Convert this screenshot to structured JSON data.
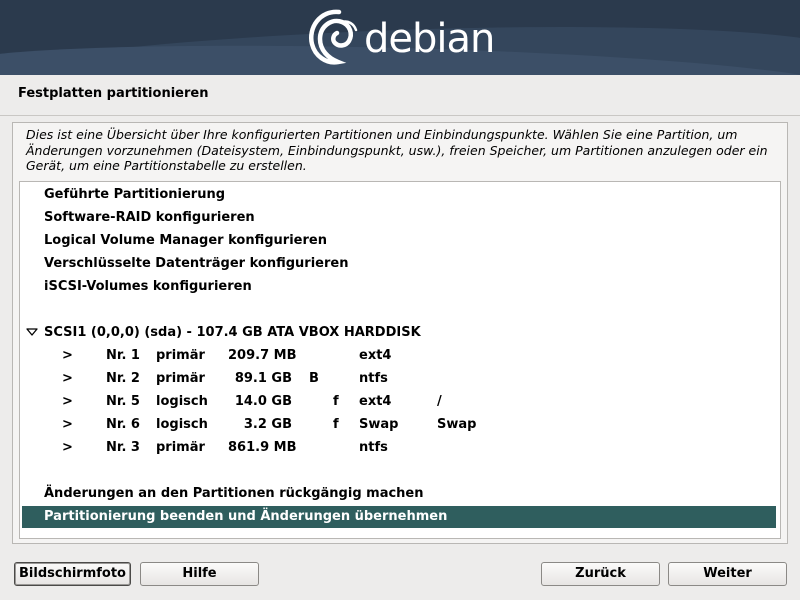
{
  "header": {
    "logo_text": "debian"
  },
  "step_title": "Festplatten partitionieren",
  "description": "Dies ist eine Übersicht über Ihre konfigurierten Partitionen und Einbindungspunkte. Wählen Sie eine Partition, um Änderungen vorzunehmen (Dateisystem, Einbindungspunkt, usw.), freien Speicher, um Partitionen anzulegen oder ein Gerät, um eine Partitionstabelle zu erstellen.",
  "menu_items": [
    "Geführte Partitionierung",
    "Software-RAID konfigurieren",
    "Logical Volume Manager konfigurieren",
    "Verschlüsselte Datenträger konfigurieren",
    "iSCSI-Volumes konfigurieren"
  ],
  "disk": {
    "label": "SCSI1 (0,0,0) (sda) - 107.4 GB ATA VBOX HARDDISK",
    "expanded": true
  },
  "partitions": [
    {
      "marker": ">",
      "nr": "Nr. 1",
      "type": "primär",
      "size": "209.7 MB",
      "flag": "",
      "fs": "ext4",
      "mount": ""
    },
    {
      "marker": ">",
      "nr": "Nr. 2",
      "type": "primär",
      "size": "89.1 GB",
      "flag": "B",
      "fs": "ntfs",
      "mount": ""
    },
    {
      "marker": ">",
      "nr": "Nr. 5",
      "type": "logisch",
      "size": "14.0 GB",
      "flag": "f",
      "fs": "ext4",
      "mount": "/"
    },
    {
      "marker": ">",
      "nr": "Nr. 6",
      "type": "logisch",
      "size": "3.2 GB",
      "flag": "f",
      "fs": "Swap",
      "mount": "Swap"
    },
    {
      "marker": ">",
      "nr": "Nr. 3",
      "type": "primär",
      "size": "861.9 MB",
      "flag": "",
      "fs": "ntfs",
      "mount": ""
    }
  ],
  "actions": {
    "undo": "Änderungen an den Partitionen rückgängig machen",
    "finish": "Partitionierung beenden und Änderungen übernehmen"
  },
  "selected_item": "finish",
  "buttons": {
    "screenshot": "Bildschirmfoto",
    "help": "Hilfe",
    "back": "Zurück",
    "next": "Weiter"
  },
  "colors": {
    "banner": "#2b3a4d",
    "selection": "#2f5e5e",
    "background": "#edeceb"
  },
  "icons": {
    "disk_toggle": "triangle-down-icon",
    "logo": "debian-swirl-icon"
  }
}
